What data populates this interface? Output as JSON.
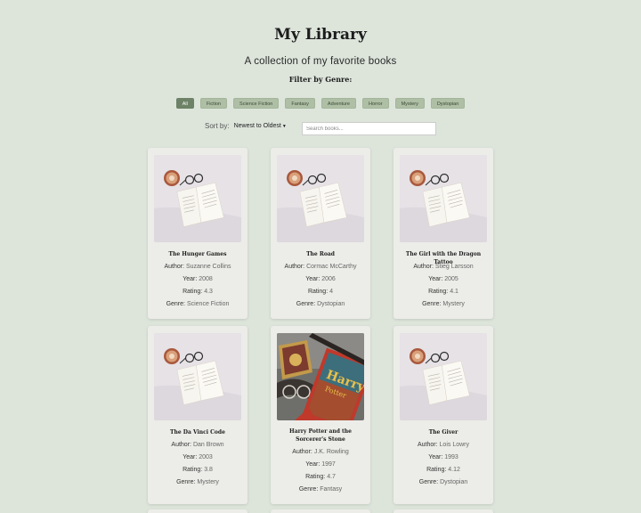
{
  "page": {
    "title": "My Library",
    "subtitle": "A collection of my favorite books",
    "filter_label": "Filter by Genre:"
  },
  "filters": [
    {
      "label": "All",
      "active": true
    },
    {
      "label": "Fiction",
      "active": false
    },
    {
      "label": "Science Fiction",
      "active": false
    },
    {
      "label": "Fantasy",
      "active": false
    },
    {
      "label": "Adventure",
      "active": false
    },
    {
      "label": "Horror",
      "active": false
    },
    {
      "label": "Mystery",
      "active": false
    },
    {
      "label": "Dystopian",
      "active": false
    }
  ],
  "sort": {
    "label": "Sort by:",
    "value": "Newest to Oldest"
  },
  "search": {
    "placeholder": "Search books..."
  },
  "field_labels": {
    "author": "Author:",
    "year": "Year:",
    "rating": "Rating:",
    "genre": "Genre:"
  },
  "books": [
    {
      "title": "The Hunger Games",
      "author": "Suzanne Collins",
      "year": "2008",
      "rating": "4.3",
      "genre": "Science Fiction",
      "cover": "coffee-book-photo"
    },
    {
      "title": "The Road",
      "author": "Cormac McCarthy",
      "year": "2006",
      "rating": "4",
      "genre": "Dystopian",
      "cover": "coffee-book-photo"
    },
    {
      "title": "The Girl with the Dragon Tattoo",
      "author": "Stieg Larsson",
      "year": "2005",
      "rating": "4.1",
      "genre": "Mystery",
      "cover": "coffee-book-photo"
    },
    {
      "title": "The Da Vinci Code",
      "author": "Dan Brown",
      "year": "2003",
      "rating": "3.8",
      "genre": "Mystery",
      "cover": "coffee-book-photo"
    },
    {
      "title": "Harry Potter and the Sorcerer's Stone",
      "author": "J.K. Rowling",
      "year": "1997",
      "rating": "4.7",
      "genre": "Fantasy",
      "cover": "harry-potter-photo"
    },
    {
      "title": "The Giver",
      "author": "Lois Lowry",
      "year": "1993",
      "rating": "4.12",
      "genre": "Dystopian",
      "cover": "coffee-book-photo"
    }
  ],
  "colors": {
    "background": "#dde5db",
    "card": "#ecece8",
    "filter_active": "#6d8266",
    "filter_inactive": "#aebfa5"
  }
}
